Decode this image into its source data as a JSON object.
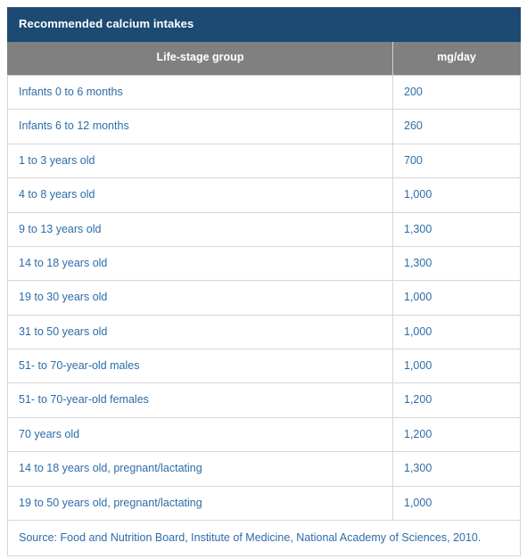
{
  "table": {
    "title": "Recommended calcium intakes",
    "columns": [
      {
        "key": "group",
        "label": "Life-stage group",
        "align": "center"
      },
      {
        "key": "value",
        "label": "mg/day",
        "align": "center"
      }
    ],
    "rows": [
      {
        "group": "Infants 0 to 6 months",
        "value": "200"
      },
      {
        "group": "Infants 6 to 12 months",
        "value": "260"
      },
      {
        "group": "1 to 3 years old",
        "value": "700"
      },
      {
        "group": "4 to 8 years old",
        "value": "1,000"
      },
      {
        "group": "9 to 13 years old",
        "value": "1,300"
      },
      {
        "group": "14 to 18 years old",
        "value": "1,300"
      },
      {
        "group": "19 to 30 years old",
        "value": "1,000"
      },
      {
        "group": "31 to 50 years old",
        "value": "1,000"
      },
      {
        "group": "51- to 70-year-old males",
        "value": "1,000"
      },
      {
        "group": "51- to 70-year-old females",
        "value": "1,200"
      },
      {
        "group": "70 years old",
        "value": "1,200"
      },
      {
        "group": "14 to 18 years old, pregnant/lactating",
        "value": "1,300"
      },
      {
        "group": "19 to 50 years old, pregnant/lactating",
        "value": "1,000"
      }
    ],
    "source": "Source: Food and Nutrition Board, Institute of Medicine, National Academy of Sciences, 2010.",
    "colors": {
      "title_bg": "#1c4a73",
      "title_text": "#ffffff",
      "colhead_bg": "#808080",
      "colhead_text": "#ffffff",
      "body_text": "#2d6ca8",
      "border": "#d6d6d6",
      "body_bg": "#ffffff"
    }
  },
  "chart_data": {
    "type": "table",
    "title": "Recommended calcium intakes",
    "categories": [
      "Infants 0 to 6 months",
      "Infants 6 to 12 months",
      "1 to 3 years old",
      "4 to 8 years old",
      "9 to 13 years old",
      "14 to 18 years old",
      "19 to 30 years old",
      "31 to 50 years old",
      "51- to 70-year-old males",
      "51- to 70-year-old females",
      "70 years old",
      "14 to 18 years old, pregnant/lactating",
      "19 to 50 years old, pregnant/lactating"
    ],
    "values": [
      200,
      260,
      700,
      1000,
      1300,
      1300,
      1000,
      1000,
      1000,
      1200,
      1200,
      1300,
      1000
    ],
    "xlabel": "Life-stage group",
    "ylabel": "mg/day",
    "annotations": [
      "Source: Food and Nutrition Board, Institute of Medicine, National Academy of Sciences, 2010."
    ]
  }
}
